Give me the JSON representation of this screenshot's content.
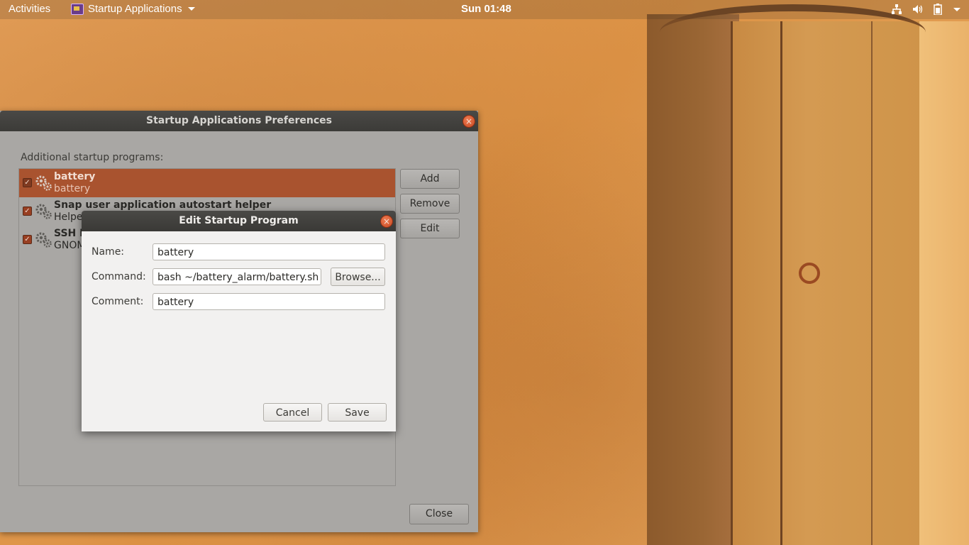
{
  "topbar": {
    "activities": "Activities",
    "app_menu": "Startup Applications",
    "clock": "Sun 01:48",
    "tray_icons": [
      "network-icon",
      "volume-icon",
      "battery-icon",
      "chevron-down-icon"
    ]
  },
  "prefs_window": {
    "title": "Startup Applications Preferences",
    "section_label": "Additional startup programs:",
    "items": [
      {
        "title": "battery",
        "subtitle": "battery",
        "checked": true,
        "selected": true
      },
      {
        "title": "Snap user application autostart helper",
        "subtitle": "Helpe",
        "checked": true,
        "selected": false
      },
      {
        "title": "SSH K",
        "subtitle": "GNOM",
        "checked": true,
        "selected": false
      }
    ],
    "buttons": {
      "add": "Add",
      "remove": "Remove",
      "edit": "Edit",
      "close": "Close"
    }
  },
  "edit_dialog": {
    "title": "Edit Startup Program",
    "name_label": "Name:",
    "name_value": "battery",
    "command_label": "Command:",
    "command_value": "bash ~/battery_alarm/battery.sh",
    "browse_label": "Browse...",
    "comment_label": "Comment:",
    "comment_value": "battery",
    "cancel_label": "Cancel",
    "save_label": "Save"
  },
  "colors": {
    "selection": "#a9532f",
    "close_button": "#e0623a",
    "titlebar": "#3c3b38"
  }
}
